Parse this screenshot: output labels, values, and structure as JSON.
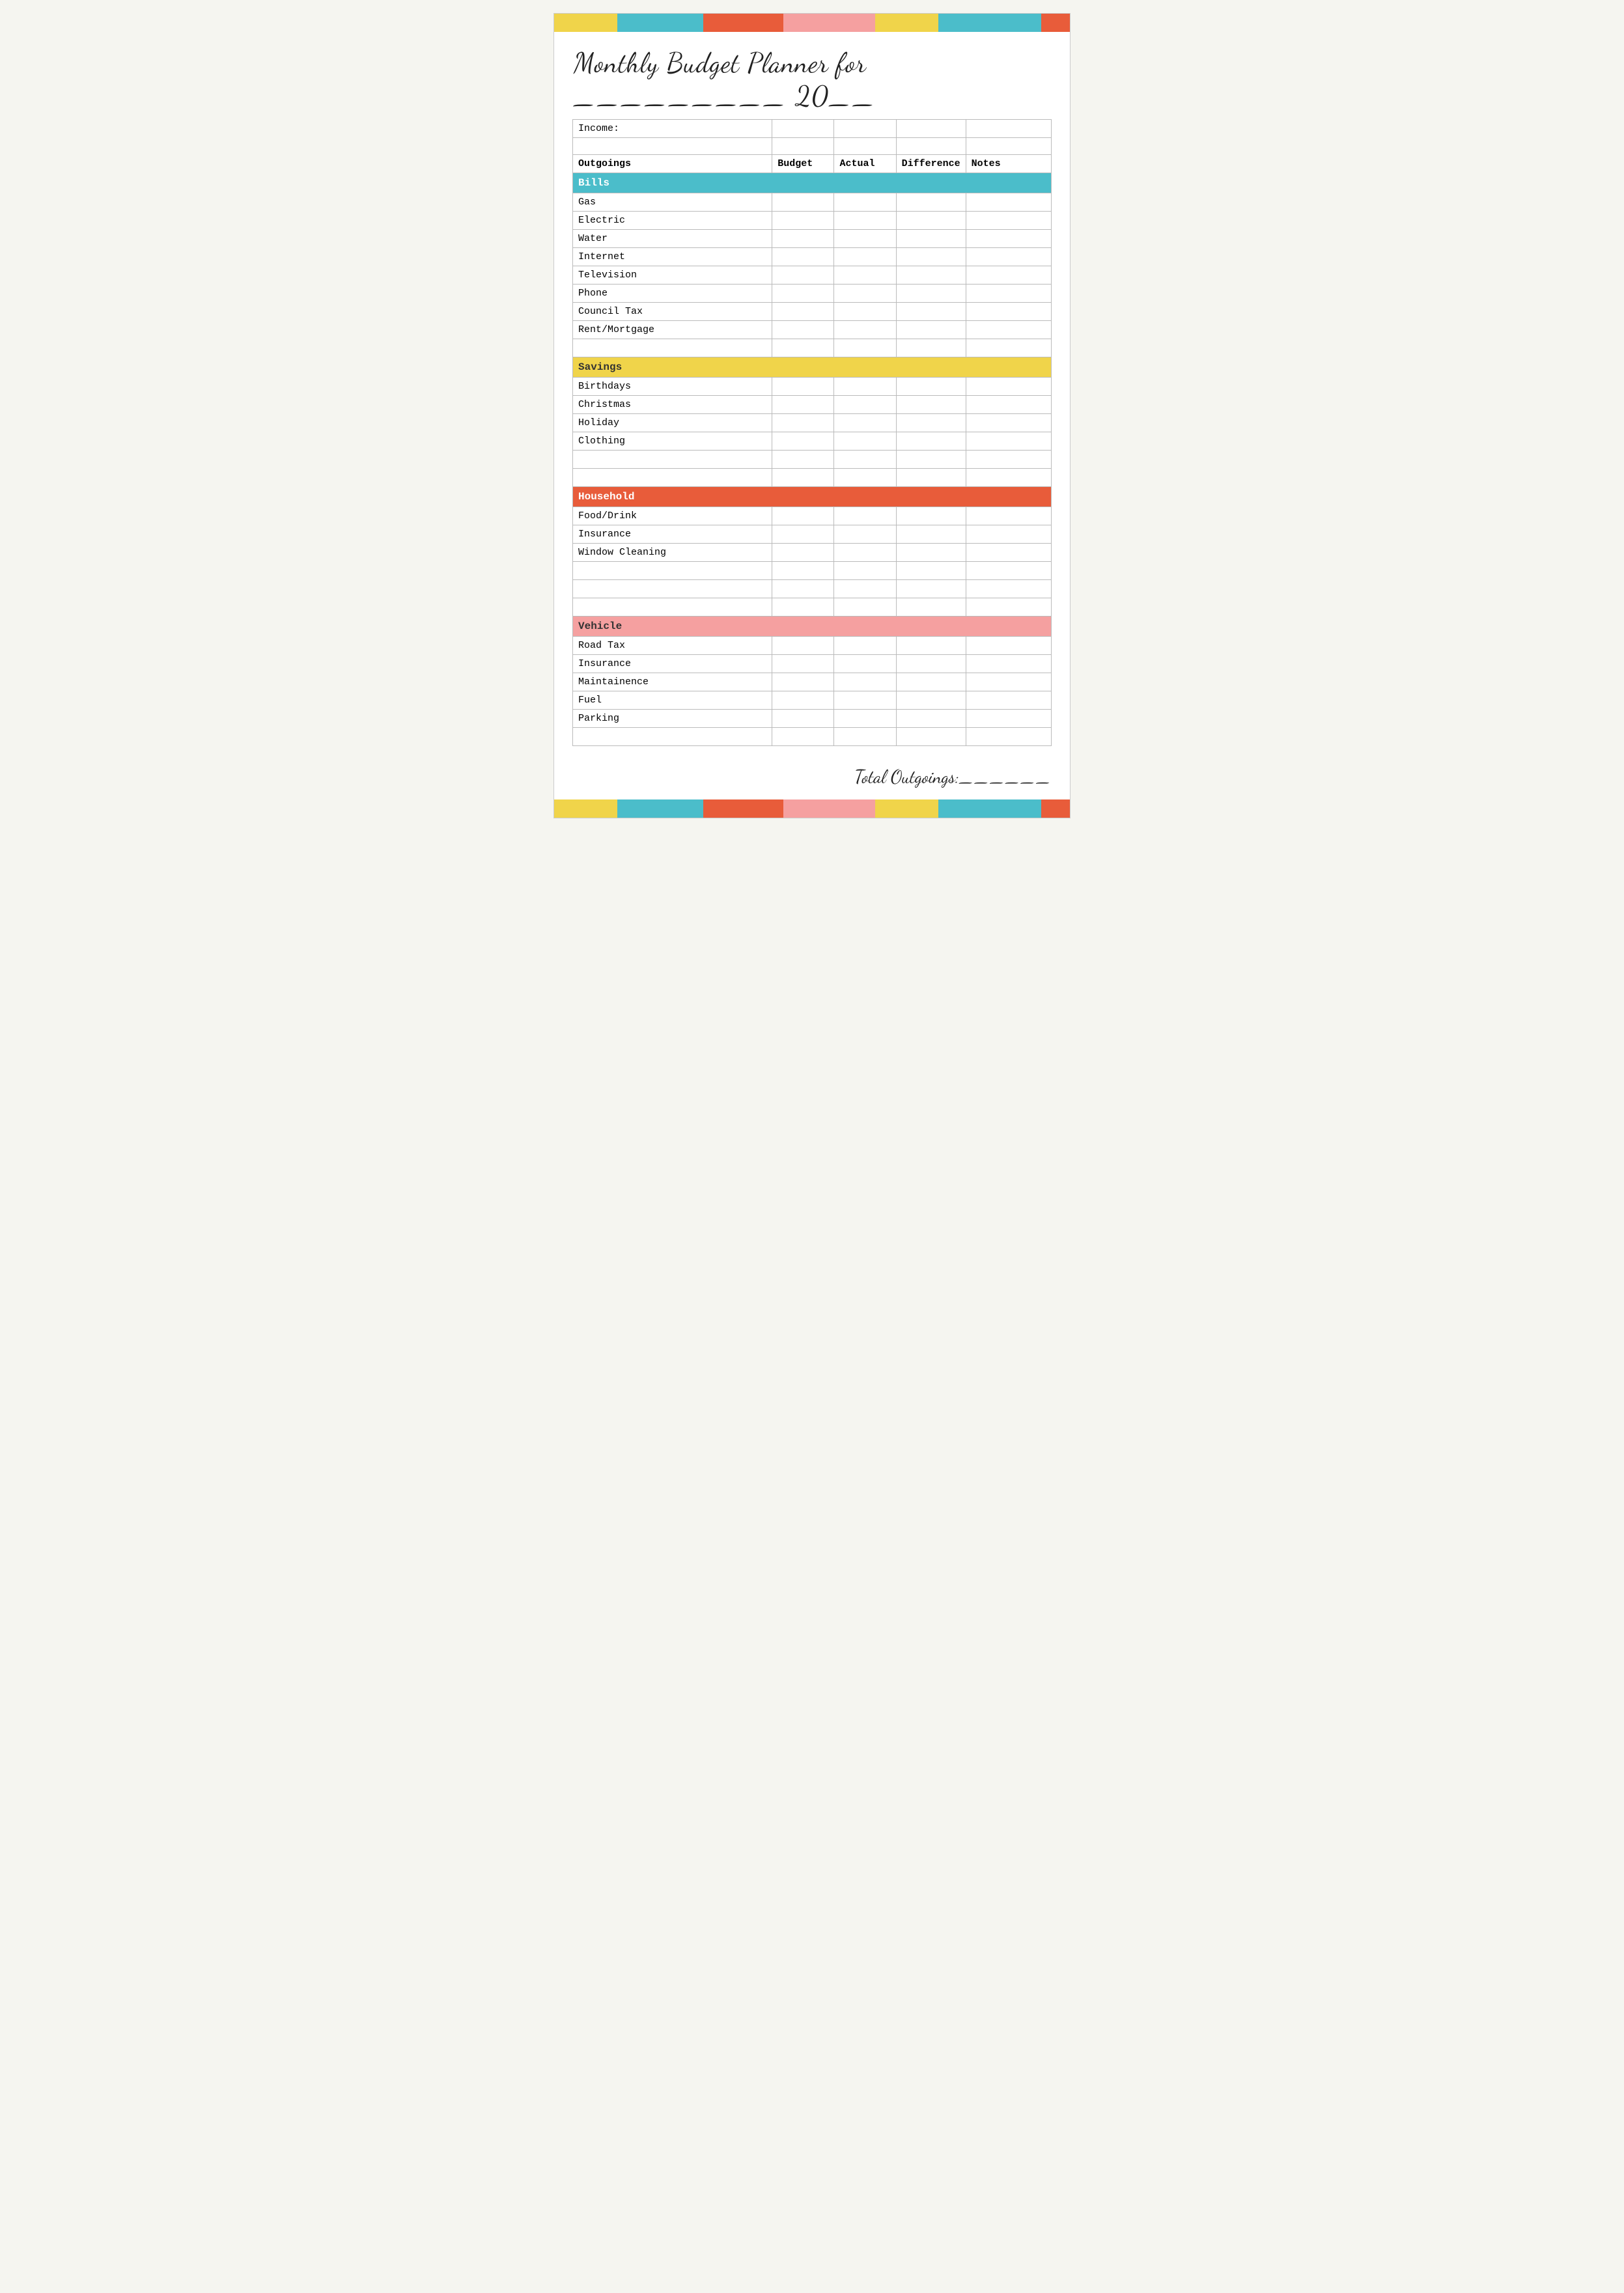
{
  "title": "Monthly Budget Planner for _________ 20__",
  "colorBar": {
    "colors": [
      "#f0d44a",
      "#4bbdca",
      "#e85c3a",
      "#f5a0a0",
      "#f0d44a",
      "#4bbdca",
      "#e85c3a"
    ]
  },
  "table": {
    "incomeLabel": "Income:",
    "columns": [
      "Outgoings",
      "Budget",
      "Actual",
      "Difference",
      "Notes"
    ],
    "sections": [
      {
        "name": "Bills",
        "color": "bills",
        "rows": [
          "Gas",
          "Electric",
          "Water",
          "Internet",
          "Television",
          "Phone",
          "Council Tax",
          "Rent/Mortgage",
          "",
          ""
        ]
      },
      {
        "name": "Savings",
        "color": "savings",
        "rows": [
          "Birthdays",
          "Christmas",
          "Holiday",
          "Clothing",
          "",
          ""
        ]
      },
      {
        "name": "Household",
        "color": "household",
        "rows": [
          "Food/Drink",
          "Insurance",
          "Window Cleaning",
          "",
          "",
          "",
          ""
        ]
      },
      {
        "name": "Vehicle",
        "color": "vehicle",
        "rows": [
          "Road Tax",
          "Insurance",
          "Maintainence",
          "Fuel",
          "Parking",
          ""
        ]
      }
    ]
  },
  "totalLabel": "Total Outgoings:______"
}
